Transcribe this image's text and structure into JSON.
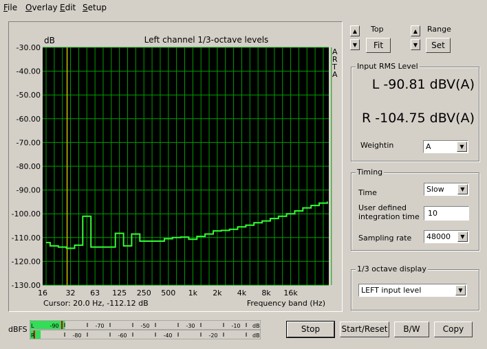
{
  "menu": [
    {
      "underline": "F",
      "rest": "ile"
    },
    {
      "underline": "O",
      "rest": "verlay"
    },
    {
      "underline": "E",
      "rest": "dit"
    },
    {
      "underline": "S",
      "rest": "etup"
    }
  ],
  "chart_data": {
    "type": "line",
    "title": "Left channel 1/3-octave levels",
    "ylabel": "dB",
    "xlabel": "Frequency band (Hz)",
    "side_label": [
      "A",
      "R",
      "T",
      "A"
    ],
    "ylim": [
      -130,
      -30
    ],
    "yticks": [
      -30,
      -40,
      -50,
      -60,
      -70,
      -80,
      -90,
      -100,
      -110,
      -120,
      -130
    ],
    "ytick_labels": [
      "-30.00",
      "-40.00",
      "-50.00",
      "-60.00",
      "-70.00",
      "-80.00",
      "-90.00",
      "-100.00",
      "-110.00",
      "-120.00",
      "-130.00"
    ],
    "xtick_labels": [
      "16",
      "32",
      "63",
      "125",
      "250",
      "500",
      "1k",
      "2k",
      "4k",
      "8k",
      "16k"
    ],
    "series": [
      {
        "values": [
          -112.12,
          -113.5,
          -114,
          -114.5,
          -113.2,
          -101,
          -114,
          -114,
          -114,
          -108.2,
          -113.5,
          -108.5,
          -111.5,
          -111.5,
          -111.5,
          -110.5,
          -110,
          -109.8,
          -110.7,
          -109.5,
          -108.5,
          -107.2,
          -107,
          -106.5,
          -105.5,
          -104.8,
          -103.8,
          -103,
          -102,
          -101,
          -100,
          -98.8,
          -97.5,
          -96.5,
          -95.5,
          -95
        ]
      }
    ],
    "cursor_band_index": 3,
    "grid": true,
    "cursor_text": "Cursor:    20.0 Hz, -112.12 dB"
  },
  "controls": {
    "top_label": "Top",
    "fit_label": "Fit",
    "range_label": "Range",
    "set_label": "Set",
    "up_arrow": "▲",
    "down_arrow": "▼"
  },
  "rms": {
    "title": "Input RMS Level",
    "left": "L -90.81 dBV(A)",
    "right": "R -104.75 dBV(A)",
    "weighting_label": "Weightin",
    "weighting_value": "A"
  },
  "timing": {
    "title": "Timing",
    "time_label": "Time",
    "time_value": "Slow",
    "integration_label_1": "User defined",
    "integration_label_2": "integration time",
    "integration_value": "10",
    "sampling_label": "Sampling rate",
    "sampling_value": "48000"
  },
  "octave": {
    "title": "1/3 octave display",
    "value": "LEFT input level"
  },
  "meter": {
    "label": "dBFS",
    "left_channel": "L",
    "right_channel": "R",
    "top_ticks": [
      "-90",
      "-70",
      "-50",
      "-30",
      "-10"
    ],
    "bottom_ticks": [
      "-80",
      "-60",
      "-40",
      "-20"
    ],
    "unit": "dB",
    "left_level_db": -90.81,
    "right_level_db": -104.75,
    "left_peak_db": -86,
    "right_peak_db": -98
  },
  "buttons": {
    "stop": "Stop",
    "start_reset": "Start/Reset",
    "bw": "B/W",
    "copy": "Copy"
  },
  "colors": {
    "plot_bg": "#000000",
    "grid": "#00a000",
    "trace": "#33ff33",
    "cursor": "#c8c800",
    "meter_fill": "#33dd55",
    "peak": "#cc0000"
  }
}
